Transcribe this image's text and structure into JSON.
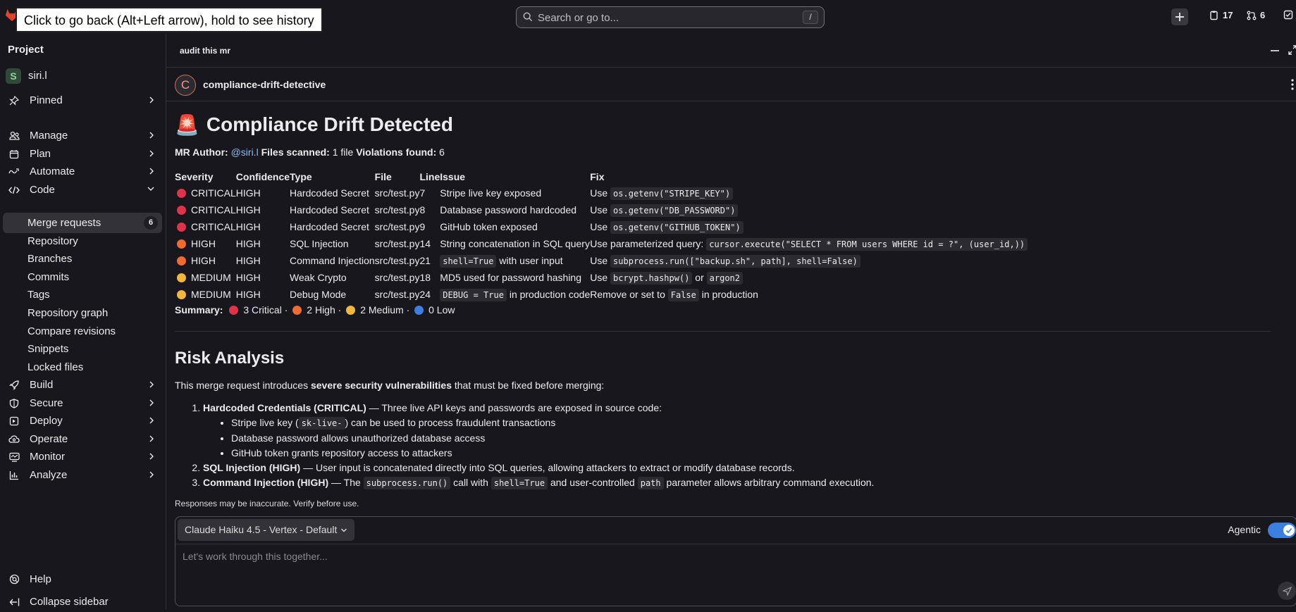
{
  "topbar": {
    "tooltip": "Click to go back (Alt+Left arrow), hold to see history",
    "search_placeholder": "Search or go to...",
    "search_shortcut": "/",
    "issues_count": "17",
    "mr_count": "6"
  },
  "sidebar": {
    "heading": "Project",
    "project_avatar": "S",
    "project_name": "siri.l",
    "pinned": "Pinned",
    "manage": "Manage",
    "plan": "Plan",
    "automate": "Automate",
    "code": "Code",
    "code_items": [
      {
        "label": "Merge requests",
        "badge": "6"
      },
      {
        "label": "Repository"
      },
      {
        "label": "Branches"
      },
      {
        "label": "Commits"
      },
      {
        "label": "Tags"
      },
      {
        "label": "Repository graph"
      },
      {
        "label": "Compare revisions"
      },
      {
        "label": "Snippets"
      },
      {
        "label": "Locked files"
      }
    ],
    "build": "Build",
    "secure": "Secure",
    "deploy": "Deploy",
    "operate": "Operate",
    "monitor": "Monitor",
    "analyze": "Analyze",
    "help": "Help",
    "collapse": "Collapse sidebar"
  },
  "panel": {
    "title": "audit this mr",
    "agent_initial": "C",
    "agent_name": "compliance-drift-detective"
  },
  "report": {
    "emoji": "🚨",
    "heading": "Compliance Drift Detected",
    "mr_author_label": "MR Author:",
    "mr_author": "@siri.l",
    "files_label": "Files scanned:",
    "files_value": "1 file",
    "violations_label": "Violations found:",
    "violations_value": "6",
    "table_headers": [
      "Severity",
      "Confidence",
      "Type",
      "File",
      "Line",
      "Issue",
      "Fix"
    ],
    "rows": [
      {
        "color": "red",
        "severity": "CRITICAL",
        "confidence": "HIGH",
        "type": "Hardcoded Secret",
        "file": "src/test.py",
        "line": "7",
        "issue_pre": "",
        "issue_code": "",
        "issue_post": "Stripe live key exposed",
        "fix_pre": "Use ",
        "fix_code": "os.getenv(\"STRIPE_KEY\")",
        "fix_mid": "",
        "fix_code2": "",
        "fix_post": ""
      },
      {
        "color": "red",
        "severity": "CRITICAL",
        "confidence": "HIGH",
        "type": "Hardcoded Secret",
        "file": "src/test.py",
        "line": "8",
        "issue_pre": "",
        "issue_code": "",
        "issue_post": "Database password hardcoded",
        "fix_pre": "Use ",
        "fix_code": "os.getenv(\"DB_PASSWORD\")",
        "fix_mid": "",
        "fix_code2": "",
        "fix_post": ""
      },
      {
        "color": "red",
        "severity": "CRITICAL",
        "confidence": "HIGH",
        "type": "Hardcoded Secret",
        "file": "src/test.py",
        "line": "9",
        "issue_pre": "",
        "issue_code": "",
        "issue_post": "GitHub token exposed",
        "fix_pre": "Use ",
        "fix_code": "os.getenv(\"GITHUB_TOKEN\")",
        "fix_mid": "",
        "fix_code2": "",
        "fix_post": ""
      },
      {
        "color": "orange",
        "severity": "HIGH",
        "confidence": "HIGH",
        "type": "SQL Injection",
        "file": "src/test.py",
        "line": "14",
        "issue_pre": "",
        "issue_code": "",
        "issue_post": "String concatenation in SQL query",
        "fix_pre": "Use parameterized query: ",
        "fix_code": "cursor.execute(\"SELECT * FROM users WHERE id = ?\", (user_id,))",
        "fix_mid": "",
        "fix_code2": "",
        "fix_post": ""
      },
      {
        "color": "orange",
        "severity": "HIGH",
        "confidence": "HIGH",
        "type": "Command Injection",
        "file": "src/test.py",
        "line": "21",
        "issue_pre": "",
        "issue_code": "shell=True",
        "issue_post": " with user input",
        "fix_pre": "Use ",
        "fix_code": "subprocess.run([\"backup.sh\", path], shell=False)",
        "fix_mid": "",
        "fix_code2": "",
        "fix_post": ""
      },
      {
        "color": "yellow",
        "severity": "MEDIUM",
        "confidence": "HIGH",
        "type": "Weak Crypto",
        "file": "src/test.py",
        "line": "18",
        "issue_pre": "",
        "issue_code": "",
        "issue_post": "MD5 used for password hashing",
        "fix_pre": "Use ",
        "fix_code": "bcrypt.hashpw()",
        "fix_mid": " or ",
        "fix_code2": "argon2",
        "fix_post": ""
      },
      {
        "color": "yellow",
        "severity": "MEDIUM",
        "confidence": "HIGH",
        "type": "Debug Mode",
        "file": "src/test.py",
        "line": "24",
        "issue_pre": "",
        "issue_code": "DEBUG = True",
        "issue_post": " in production code",
        "fix_pre": "Remove or set to ",
        "fix_code": "False",
        "fix_mid": "",
        "fix_code2": "",
        "fix_post": " in production"
      }
    ],
    "summary_label": "Summary:",
    "summary_critical": "3 Critical",
    "summary_high": "2 High",
    "summary_medium": "2 Medium",
    "summary_low": "0 Low",
    "separator": "·",
    "risk_heading": "Risk Analysis",
    "risk_intro_pre": "This merge request introduces ",
    "risk_intro_bold": "severe security vulnerabilities",
    "risk_intro_post": " that must be fixed before merging:",
    "item1_bold": "Hardcoded Credentials (CRITICAL)",
    "item1_text": " — Three live API keys and passwords are exposed in source code:",
    "item1_sub1_pre": "Stripe live key (",
    "item1_sub1_code": "sk-live-",
    "item1_sub1_post": ") can be used to process fraudulent transactions",
    "item1_sub2": "Database password allows unauthorized database access",
    "item1_sub3": "GitHub token grants repository access to attackers",
    "item2_bold": "SQL Injection (HIGH)",
    "item2_text": " — User input is concatenated directly into SQL queries, allowing attackers to extract or modify database records.",
    "item3_bold": "Command Injection (HIGH)",
    "item3_pre": " — The ",
    "item3_code1": "subprocess.run()",
    "item3_mid1": " call with ",
    "item3_code2": "shell=True",
    "item3_mid2": " and user-controlled ",
    "item3_code3": "path",
    "item3_post": " parameter allows arbitrary command execution."
  },
  "composer": {
    "disclaimer": "Responses may be inaccurate. Verify before use.",
    "model": "Claude Haiku 4.5 - Vertex - Default",
    "agentic_label": "Agentic",
    "agentic_on": true,
    "placeholder": "Let's work through this together..."
  }
}
